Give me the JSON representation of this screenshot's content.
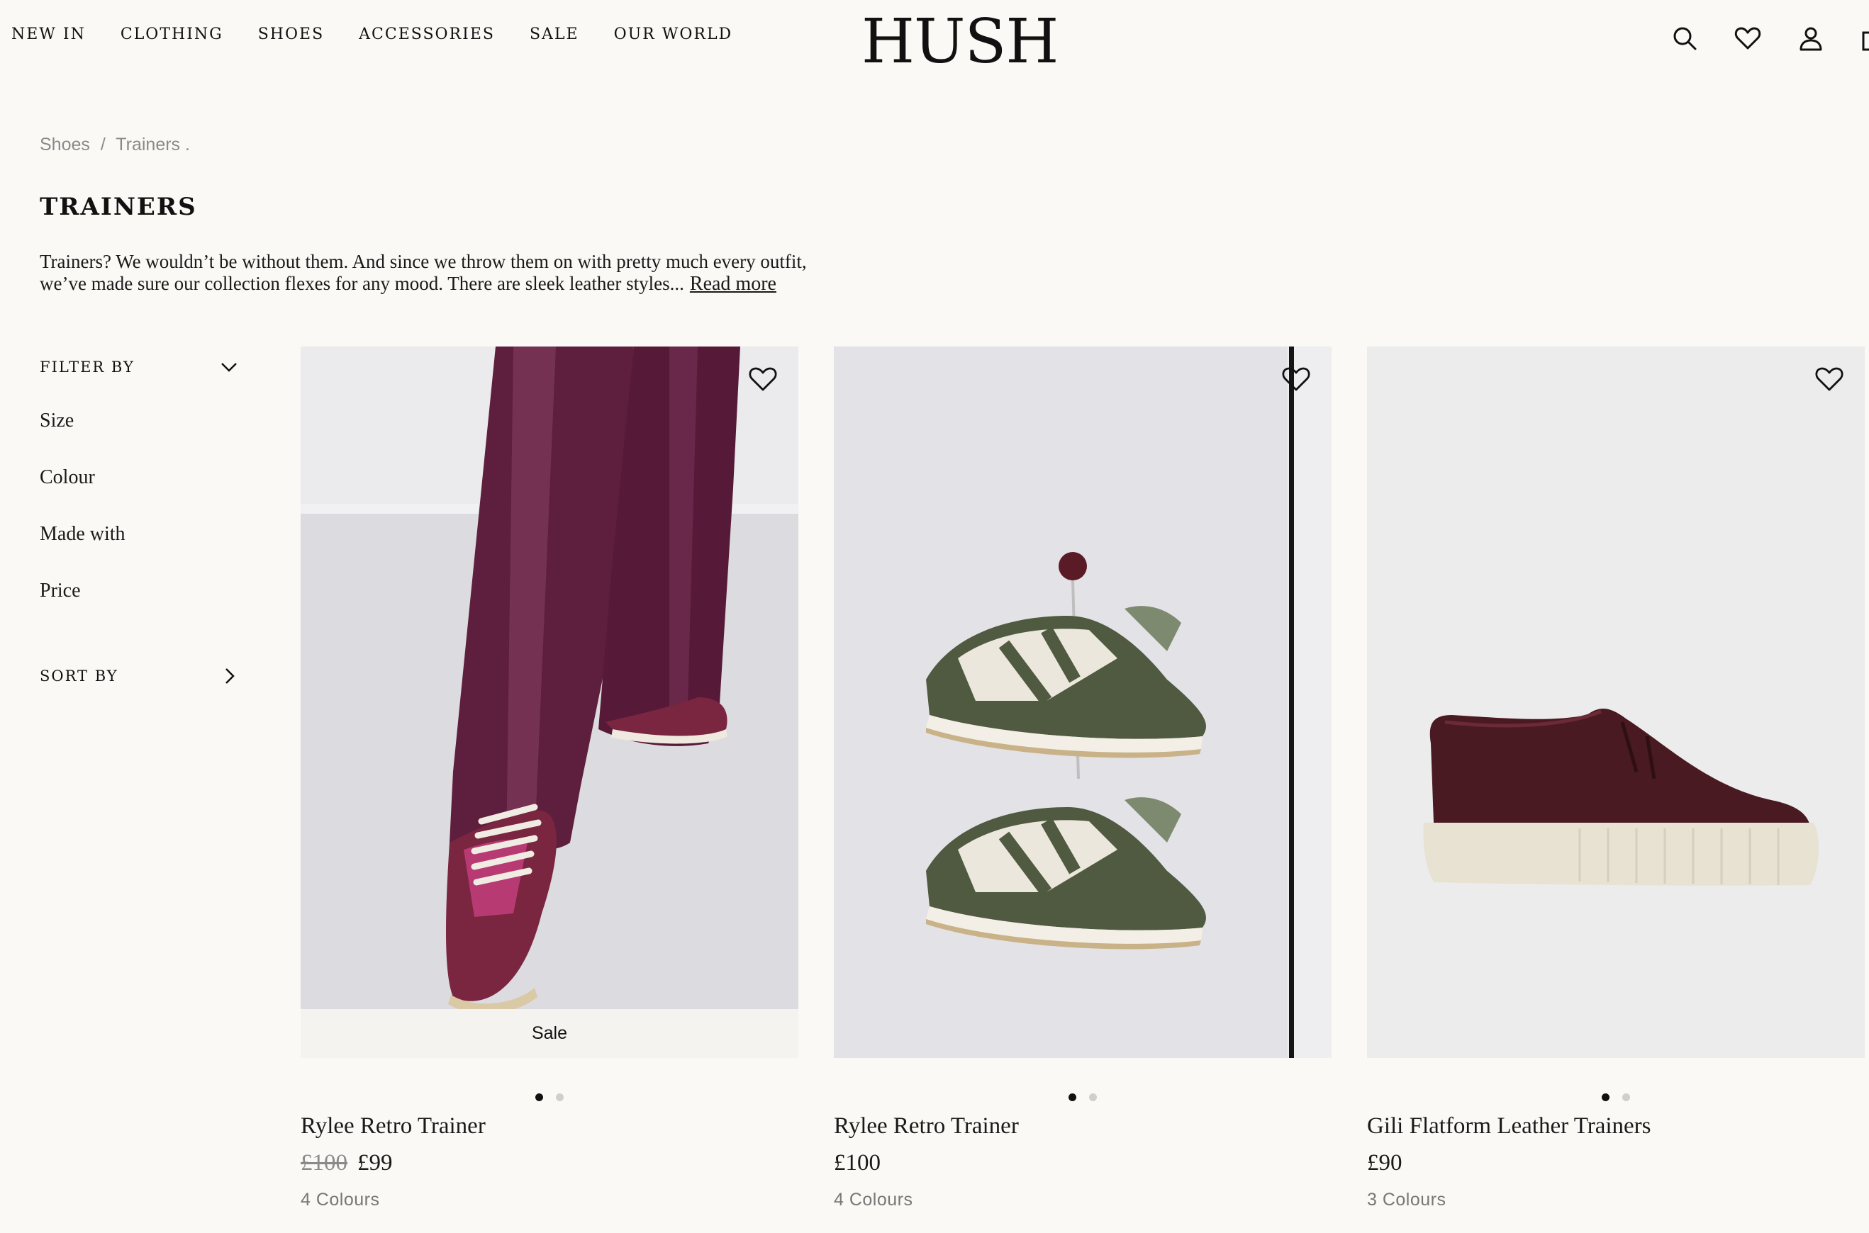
{
  "header": {
    "nav": [
      "NEW IN",
      "CLOTHING",
      "SHOES",
      "ACCESSORIES",
      "SALE",
      "OUR WORLD"
    ],
    "logo": "HUSH",
    "icons": [
      "search-icon",
      "heart-icon",
      "account-icon",
      "bag-icon"
    ]
  },
  "breadcrumb": {
    "items": [
      "Shoes",
      "Trainers ."
    ],
    "separator": "/"
  },
  "page": {
    "title": "TRAINERS",
    "intro": "Trainers? We wouldn’t be without them. And since we throw them on with pretty much every outfit, we’ve made sure our collection flexes for any mood. There are sleek leather styles...",
    "read_more": "Read more"
  },
  "sidebar": {
    "filter_label": "FILTER BY",
    "filters": [
      "Size",
      "Colour",
      "Made with",
      "Price"
    ],
    "sort_label": "SORT BY"
  },
  "products": [
    {
      "name": "Rylee Retro Trainer",
      "was_price": "£100",
      "price": "£99",
      "colours": "4 Colours",
      "badge": "Sale",
      "image_dots": 2,
      "active_dot": 1
    },
    {
      "name": "Rylee Retro Trainer",
      "was_price": "",
      "price": "£100",
      "colours": "4 Colours",
      "badge": "",
      "image_dots": 2,
      "active_dot": 1
    },
    {
      "name": "Gili Flatform Leather Trainers",
      "was_price": "",
      "price": "£90",
      "colours": "3 Colours",
      "badge": "",
      "image_dots": 2,
      "active_dot": 1
    }
  ],
  "colors": {
    "background": "#faf9f6",
    "text": "#1a1a1a",
    "muted": "#8a8a8a",
    "plum": "#5e1e3e",
    "olive": "#4f5a40",
    "burgundy": "#4a1a22"
  }
}
